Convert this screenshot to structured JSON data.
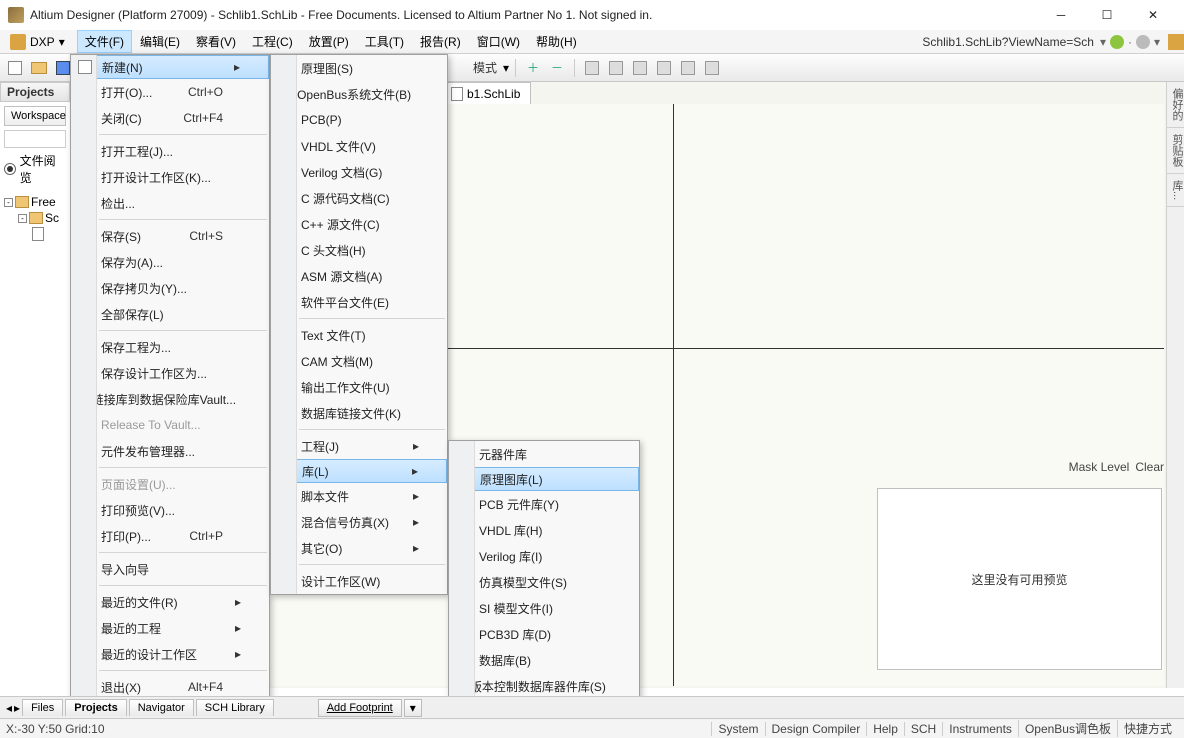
{
  "window": {
    "title": "Altium Designer (Platform 27009) - Schlib1.SchLib - Free Documents. Licensed to Altium Partner No 1. Not signed in."
  },
  "menubar": {
    "dxp": "DXP",
    "items": [
      "文件(F)",
      "编辑(E)",
      "察看(V)",
      "工程(C)",
      "放置(P)",
      "工具(T)",
      "报告(R)",
      "窗口(W)",
      "帮助(H)"
    ],
    "crumb": "Schlib1.SchLib?ViewName=Sch"
  },
  "toolbar": {
    "mode": "模式"
  },
  "panels": {
    "projects": "Projects",
    "workspace": "Workspace",
    "file_browse": "文件阅览"
  },
  "tree": {
    "root": "Free",
    "child": "Sc"
  },
  "doc": {
    "tab": "b1.SchLib"
  },
  "file_menu": [
    {
      "label": "新建(N)",
      "shortcut": "",
      "arrow": true,
      "hl": true,
      "icon": "new"
    },
    {
      "label": "打开(O)...",
      "shortcut": "Ctrl+O",
      "icon": "open"
    },
    {
      "label": "关闭(C)",
      "shortcut": "Ctrl+F4"
    },
    {
      "sep": true
    },
    {
      "label": "打开工程(J)...",
      "icon": "open"
    },
    {
      "label": "打开设计工作区(K)..."
    },
    {
      "label": "检出..."
    },
    {
      "sep": true
    },
    {
      "label": "保存(S)",
      "shortcut": "Ctrl+S",
      "icon": "save"
    },
    {
      "label": "保存为(A)..."
    },
    {
      "label": "保存拷贝为(Y)..."
    },
    {
      "label": "全部保存(L)"
    },
    {
      "sep": true
    },
    {
      "label": "保存工程为..."
    },
    {
      "label": "保存设计工作区为..."
    },
    {
      "label": "链接库到数据保险库Vault..."
    },
    {
      "label": "Release To Vault...",
      "dis": true
    },
    {
      "label": "元件发布管理器..."
    },
    {
      "sep": true
    },
    {
      "label": "页面设置(U)...",
      "dis": true
    },
    {
      "label": "打印预览(V)...",
      "icon": "chip"
    },
    {
      "label": "打印(P)...",
      "shortcut": "Ctrl+P",
      "icon": "chip"
    },
    {
      "sep": true
    },
    {
      "label": "导入向导"
    },
    {
      "sep": true
    },
    {
      "label": "最近的文件(R)",
      "arrow": true
    },
    {
      "label": "最近的工程",
      "arrow": true
    },
    {
      "label": "最近的设计工作区",
      "arrow": true
    },
    {
      "sep": true
    },
    {
      "label": "退出(X)",
      "shortcut": "Alt+F4"
    }
  ],
  "new_menu": [
    {
      "label": "原理图(S)",
      "icon": "chip"
    },
    {
      "label": "OpenBus系统文件(B)",
      "icon": "chip"
    },
    {
      "label": "PCB(P)",
      "icon": "chip"
    },
    {
      "label": "VHDL 文件(V)",
      "icon": "chip"
    },
    {
      "label": "Verilog 文档(G)",
      "icon": "chip"
    },
    {
      "label": "C 源代码文档(C)",
      "icon": "chip"
    },
    {
      "label": "C++ 源文件(C)",
      "icon": "chip"
    },
    {
      "label": "C 头文档(H)",
      "icon": "chip"
    },
    {
      "label": "ASM 源文档(A)",
      "icon": "chip"
    },
    {
      "label": "软件平台文件(E)",
      "icon": "chip"
    },
    {
      "sep": true
    },
    {
      "label": "Text 文件(T)",
      "icon": "chip"
    },
    {
      "label": "CAM 文档(M)",
      "icon": "chip"
    },
    {
      "label": "输出工作文件(U)",
      "icon": "chip"
    },
    {
      "label": "数据库链接文件(K)",
      "icon": "chip"
    },
    {
      "sep": true
    },
    {
      "label": "工程(J)",
      "arrow": true
    },
    {
      "label": "库(L)",
      "arrow": true,
      "hl": true
    },
    {
      "label": "脚本文件",
      "arrow": true
    },
    {
      "label": "混合信号仿真(X)",
      "arrow": true
    },
    {
      "label": "其它(O)",
      "arrow": true
    },
    {
      "sep": true
    },
    {
      "label": "设计工作区(W)",
      "icon": "chip"
    }
  ],
  "lib_menu": [
    {
      "label": "元器件库",
      "icon": "chip"
    },
    {
      "label": "原理图库(L)",
      "icon": "chip",
      "hl": true
    },
    {
      "label": "PCB 元件库(Y)",
      "icon": "chip"
    },
    {
      "label": "VHDL 库(H)",
      "icon": "chip"
    },
    {
      "label": "Verilog 库(I)",
      "icon": "chip"
    },
    {
      "label": "仿真模型文件(S)",
      "icon": "chip"
    },
    {
      "label": "SI 模型文件(I)",
      "icon": "chip"
    },
    {
      "label": "PCB3D 库(D)",
      "icon": "chip"
    },
    {
      "label": "数据库(B)",
      "icon": "chip"
    },
    {
      "label": "版本控制数据库器件库(S)",
      "icon": "chip"
    }
  ],
  "right_tabs": [
    "偏好的",
    "剪贴板",
    "库..."
  ],
  "bottom": {
    "tabs": [
      "Files",
      "Projects",
      "Navigator",
      "SCH Library"
    ],
    "add_footprint": "Add Footprint",
    "mask": "Mask Level",
    "clear": "Clear",
    "preview": "这里没有可用预览"
  },
  "status": {
    "coord": "X:-30 Y:50  Grid:10",
    "items": [
      "System",
      "Design Compiler",
      "Help",
      "SCH",
      "Instruments",
      "OpenBus调色板",
      "快捷方式"
    ]
  }
}
